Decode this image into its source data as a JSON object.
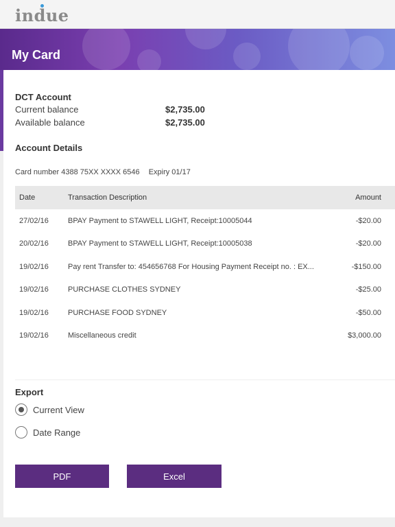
{
  "header": {
    "logo_text": "indue"
  },
  "banner": {
    "title": "My Card"
  },
  "account": {
    "title": "DCT Account",
    "current_balance_label": "Current balance",
    "current_balance": "$2,735.00",
    "available_balance_label": "Available balance",
    "available_balance": "$2,735.00"
  },
  "details": {
    "title": "Account Details",
    "card_number": "Card number 4388 75XX XXXX 6546",
    "expiry": "Expiry 01/17"
  },
  "table": {
    "headers": {
      "date": "Date",
      "description": "Transaction Description",
      "amount": "Amount"
    },
    "rows": [
      {
        "date": "27/02/16",
        "description": "BPAY Payment to STAWELL LIGHT, Receipt:10005044",
        "amount": "-$20.00"
      },
      {
        "date": "20/02/16",
        "description": "BPAY Payment to STAWELL LIGHT, Receipt:10005038",
        "amount": "-$20.00"
      },
      {
        "date": "19/02/16",
        "description": "Pay rent Transfer to: 454656768 For Housing Payment Receipt no. : EX...",
        "amount": "-$150.00"
      },
      {
        "date": "19/02/16",
        "description": "PURCHASE CLOTHES SYDNEY",
        "amount": "-$25.00"
      },
      {
        "date": "19/02/16",
        "description": "PURCHASE FOOD SYDNEY",
        "amount": "-$50.00"
      },
      {
        "date": "19/02/16",
        "description": "Miscellaneous credit",
        "amount": "$3,000.00"
      }
    ]
  },
  "export": {
    "title": "Export",
    "options": [
      {
        "label": "Current View",
        "selected": true
      },
      {
        "label": "Date Range",
        "selected": false
      }
    ],
    "pdf_label": "PDF",
    "excel_label": "Excel"
  },
  "colors": {
    "brand_purple": "#5b2d80",
    "logo_dot": "#3a9ad9"
  }
}
